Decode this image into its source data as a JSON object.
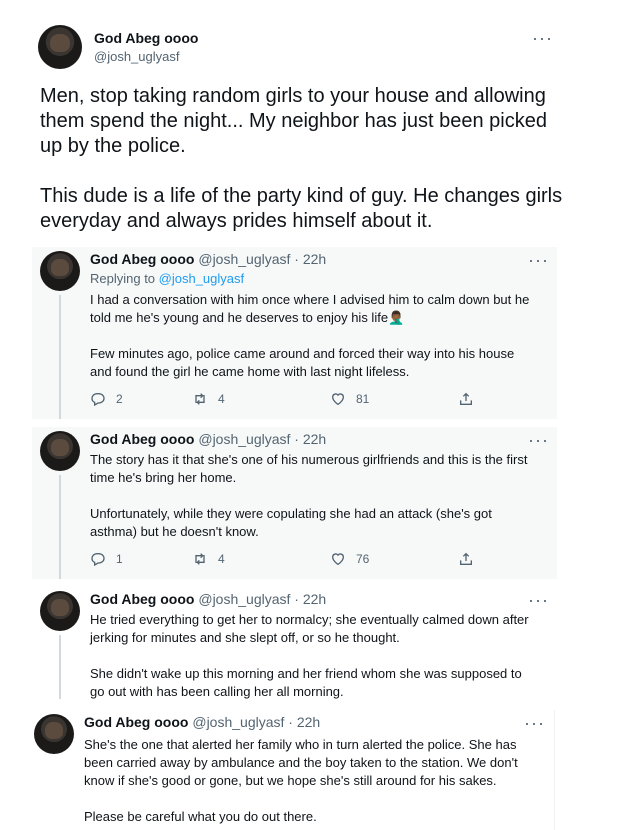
{
  "tweet": {
    "author_name": "God Abeg oooo",
    "author_handle": "@josh_uglyasf",
    "text": "Men, stop taking random girls to your house and allowing them spend the night... My neighbor has just been picked up by the police.\n\nThis dude is a life of the party kind of guy. He changes girls everyday and always prides himself about it."
  },
  "replies": [
    {
      "author_name": "God Abeg oooo",
      "author_handle": "@josh_uglyasf",
      "time": "22h",
      "replying_prefix": "Replying to ",
      "replying_handle": "@josh_uglyasf",
      "text": "I had a conversation with him once where I advised him to calm down but he told me he's young and he deserves to enjoy his life🤦🏾‍♂️\n\nFew minutes ago, police came around and forced their way into his house and found the girl he came home with last night lifeless.",
      "replies_count": "2",
      "retweets_count": "4",
      "likes_count": "81"
    },
    {
      "author_name": "God Abeg oooo",
      "author_handle": "@josh_uglyasf",
      "time": "22h",
      "text": "The story has it that she's one of his numerous girlfriends and this is the first time he's bring her home.\n\nUnfortunately, while they were copulating she had an attack (she's got asthma) but he doesn't know.",
      "replies_count": "1",
      "retweets_count": "4",
      "likes_count": "76"
    },
    {
      "author_name": "God Abeg oooo",
      "author_handle": "@josh_uglyasf",
      "time": "22h",
      "text": "He tried everything to get her to normalcy; she eventually calmed down after jerking for minutes and she slept off, or so he thought.\n\nShe didn't wake up this morning and her friend whom she was supposed to go out with has been calling her all morning."
    },
    {
      "author_name": "God Abeg oooo",
      "author_handle": "@josh_uglyasf",
      "time": "22h",
      "text": "She's the one that alerted her family who in turn alerted the police. She has been carried away by ambulance and the boy taken to the station. We don't know if she's good or gone, but we hope she's still around for his sakes.\n\nPlease be careful what you do out there."
    }
  ],
  "ui": {
    "more_label": "···",
    "dot": "·",
    "accent_color": "#1d9bf0"
  }
}
